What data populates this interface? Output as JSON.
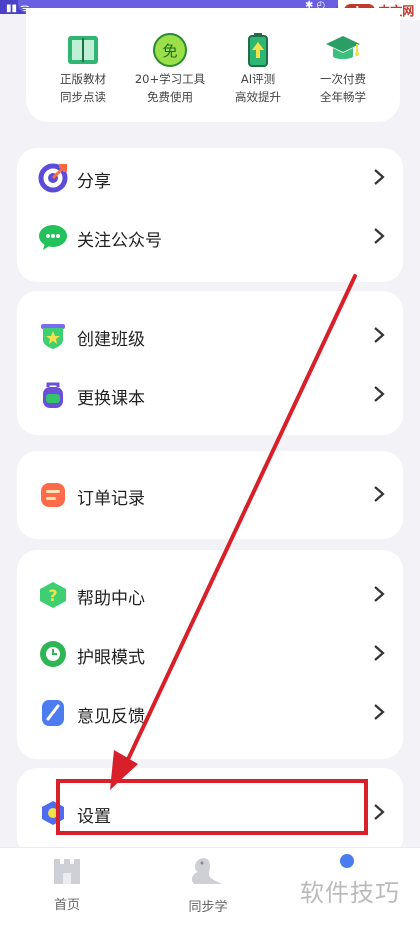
{
  "watermarks": {
    "top_badge": "php",
    "top_text": "中文网",
    "bottom_text": "软件技巧"
  },
  "benefits": [
    {
      "icon": "book-icon",
      "line1": "正版教材",
      "line2": "同步点读"
    },
    {
      "icon": "free-icon",
      "icon_text": "免",
      "line1": "20+学习工具",
      "line2": "免费使用"
    },
    {
      "icon": "battery-icon",
      "line1": "AI评测",
      "line2": "高效提升"
    },
    {
      "icon": "graduation-cap-icon",
      "line1": "一次付费",
      "line2": "全年畅学"
    }
  ],
  "menu": {
    "share": {
      "label": "分享",
      "icon": "share-icon"
    },
    "follow": {
      "label": "关注公众号",
      "icon": "wechat-icon"
    },
    "create_class": {
      "label": "创建班级",
      "icon": "class-badge-icon"
    },
    "change_book": {
      "label": "更换课本",
      "icon": "backpack-icon"
    },
    "orders": {
      "label": "订单记录",
      "icon": "order-list-icon"
    },
    "help": {
      "label": "帮助中心",
      "icon": "help-icon"
    },
    "eye_mode": {
      "label": "护眼模式",
      "icon": "eye-care-icon"
    },
    "feedback": {
      "label": "意见反馈",
      "icon": "feedback-pen-icon"
    },
    "settings": {
      "label": "设置",
      "icon": "settings-icon"
    }
  },
  "tabs": [
    {
      "label": "首页",
      "icon": "home-castle-icon"
    },
    {
      "label": "同步学",
      "icon": "seal-icon"
    }
  ],
  "colors": {
    "accent": "#4a41c7",
    "annotation": "#d8202a"
  }
}
